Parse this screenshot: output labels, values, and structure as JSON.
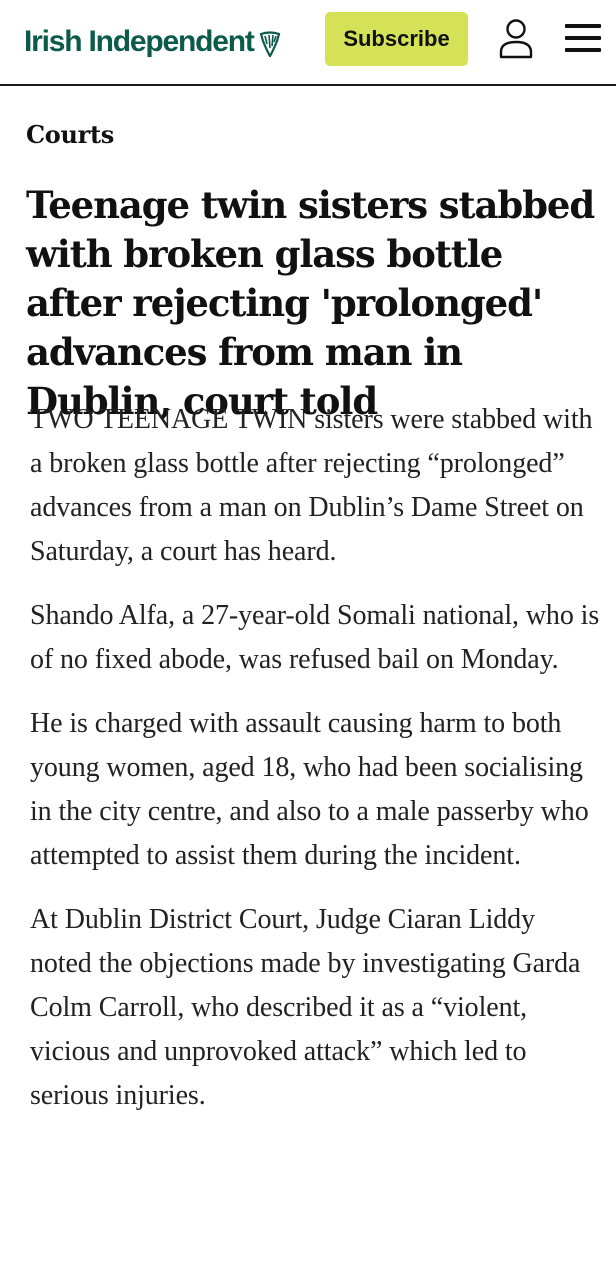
{
  "header": {
    "brand": "Irish Independent",
    "brand_icon": "harp-icon",
    "subscribe_label": "Subscribe",
    "account_icon": "account-icon",
    "menu_icon": "hamburger-menu-icon",
    "colors": {
      "brand": "#0b5a4a",
      "subscribe_bg": "#d5e258"
    }
  },
  "article": {
    "section": "Courts",
    "headline": "Teenage twin sisters stabbed with broken glass bottle after rejecting 'prolonged' advances from man in Dublin, court told",
    "paragraphs": [
      "TWO TEENAGE TWIN sisters were stabbed with a broken glass bottle after rejecting “prolonged” advances from a man on Dublin’s Dame Street on Saturday, a court has heard.",
      "Shando Alfa, a 27-year-old Somali national, who is of no fixed abode, was refused bail on Monday.",
      "He is charged with assault causing harm to both young women, aged 18, who had been socialising in the city centre, and also to a male passerby who attempted to assist them during the incident.",
      "At Dublin District Court, Judge Ciaran Liddy noted the objections made by investigating Garda Colm Carroll, who described it as a “violent, vicious and unprovoked attack” which led to serious injuries."
    ]
  }
}
